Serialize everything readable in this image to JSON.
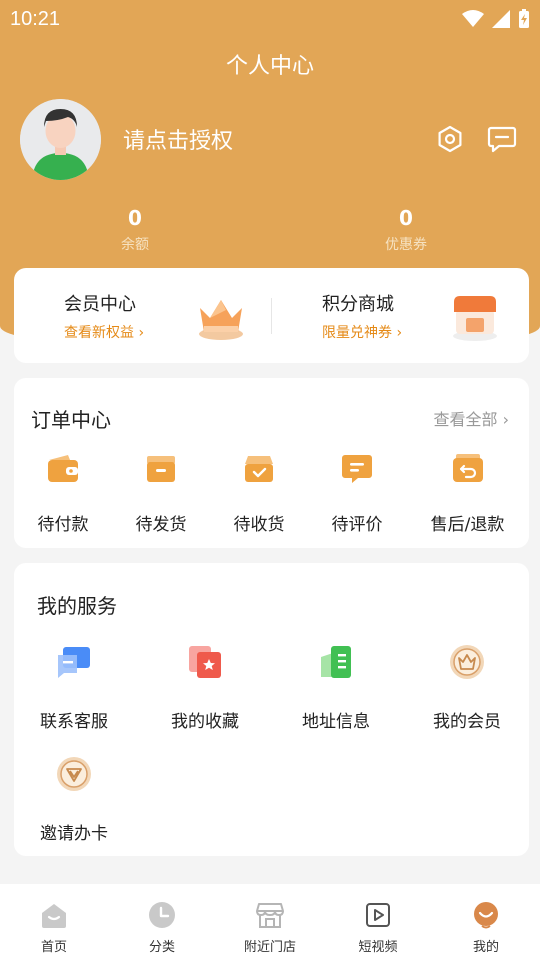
{
  "status": {
    "time": "10:21"
  },
  "header": {
    "title": "个人中心"
  },
  "profile": {
    "name": "请点击授权"
  },
  "stats": [
    {
      "value": "0",
      "label": "余额"
    },
    {
      "value": "0",
      "label": "优惠券"
    }
  ],
  "promo": [
    {
      "title": "会员中心",
      "subtitle": "查看新权益 ›"
    },
    {
      "title": "积分商城",
      "subtitle": "限量兑神券 ›"
    }
  ],
  "orders": {
    "title": "订单中心",
    "see_all": "查看全部 ›",
    "items": [
      {
        "label": "待付款",
        "icon": "wallet-icon"
      },
      {
        "label": "待发货",
        "icon": "box-icon"
      },
      {
        "label": "待收货",
        "icon": "box-check-icon"
      },
      {
        "label": "待评价",
        "icon": "comment-icon"
      },
      {
        "label": "售后/退款",
        "icon": "refund-icon"
      }
    ]
  },
  "services": {
    "title": "我的服务",
    "items": [
      {
        "label": "联系客服",
        "icon": "chat-icon"
      },
      {
        "label": "我的收藏",
        "icon": "favorite-icon"
      },
      {
        "label": "地址信息",
        "icon": "address-icon"
      },
      {
        "label": "我的会员",
        "icon": "crown-icon"
      },
      {
        "label": "邀请办卡",
        "icon": "invite-icon"
      }
    ]
  },
  "tabbar": [
    {
      "label": "首页",
      "icon": "home-icon"
    },
    {
      "label": "分类",
      "icon": "clock-icon"
    },
    {
      "label": "附近门店",
      "icon": "store-icon"
    },
    {
      "label": "短视频",
      "icon": "video-icon"
    },
    {
      "label": "我的",
      "icon": "profile-icon",
      "active": true
    }
  ],
  "colors": {
    "brand": "#e2a656",
    "accent": "#e58a17",
    "background": "#f4f4f4"
  }
}
